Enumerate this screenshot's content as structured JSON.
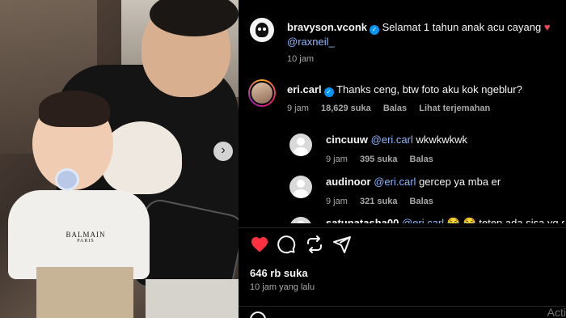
{
  "post_image": {
    "shirt_text": "BALMAIN",
    "shirt_subtext": "PARIS",
    "next_label": "›"
  },
  "comments": [
    {
      "username": "bravyson.vconk",
      "text": "Selamat 1 tahun anak acu cayang",
      "emoji": "♥",
      "mention": "@raxneil_",
      "time": "10 jam"
    },
    {
      "username": "eri.carl",
      "text": "Thanks ceng, btw foto aku kok ngeblur?",
      "time": "9 jam",
      "likes": "18,629 suka",
      "reply": "Balas",
      "translate": "Lihat terjemahan"
    }
  ],
  "replies": [
    {
      "username": "cincuuw",
      "mention": "@eri.carl",
      "text": "wkwkwkwk",
      "time": "9 jam",
      "likes": "395 suka",
      "reply": "Balas"
    },
    {
      "username": "audinoor",
      "mention": "@eri.carl",
      "text": "gercep ya mba er",
      "time": "9 jam",
      "likes": "321 suka",
      "reply": "Balas"
    }
  ],
  "partial_reply": {
    "username": "satunatasha00",
    "mention": "@eri.carl",
    "text": "😂 😂 tetep ada sisa yg salah"
  },
  "post_footer": {
    "likes": "646 rb suka",
    "time": "10 jam yang lalu"
  },
  "watermark": "Acti",
  "colors": {
    "verified": "#0095f6",
    "heart": "#ed4956",
    "mention": "#8fb8ff"
  }
}
